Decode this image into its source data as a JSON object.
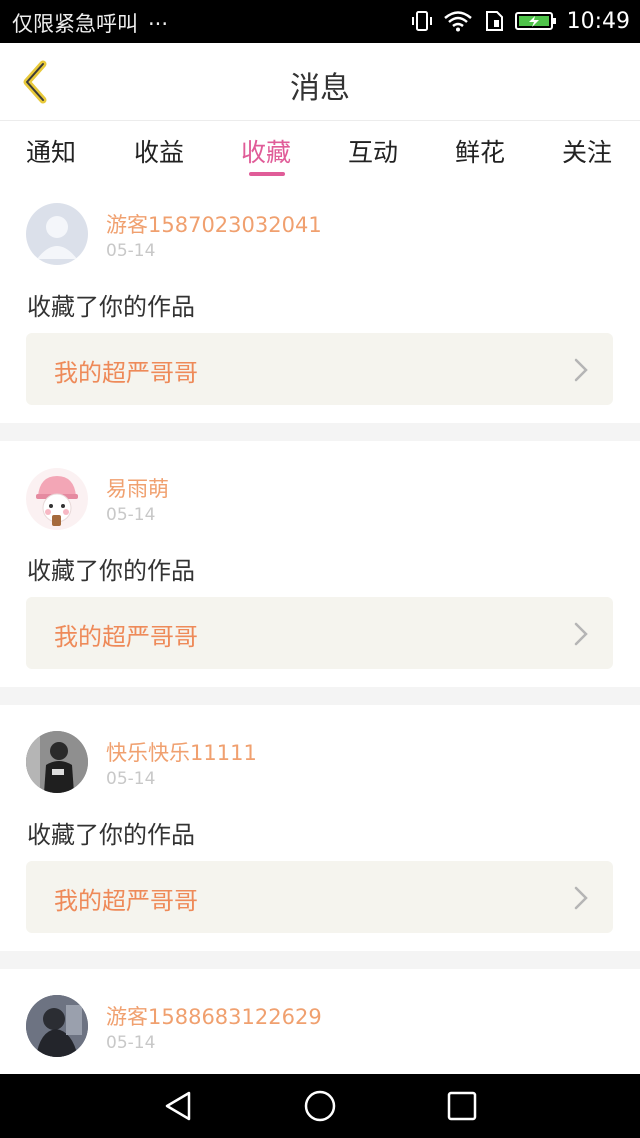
{
  "status_bar": {
    "carrier": "仅限紧急呼叫",
    "dots": "···",
    "time": "10:49"
  },
  "header": {
    "title": "消息"
  },
  "tabs": [
    {
      "label": "通知"
    },
    {
      "label": "收益"
    },
    {
      "label": "收藏",
      "active": true
    },
    {
      "label": "互动"
    },
    {
      "label": "鲜花"
    },
    {
      "label": "关注"
    }
  ],
  "items": [
    {
      "username": "游客1587023032041",
      "date": "05-14",
      "action": "收藏了你的作品",
      "work_title": "我的超严哥哥",
      "avatar": "default-avatar"
    },
    {
      "username": "易雨萌",
      "date": "05-14",
      "action": "收藏了你的作品",
      "work_title": "我的超严哥哥",
      "avatar": "cartoon-bear-avatar"
    },
    {
      "username": "快乐快乐11111",
      "date": "05-14",
      "action": "收藏了你的作品",
      "work_title": "我的超严哥哥",
      "avatar": "photo-avatar"
    },
    {
      "username": "游客1588683122629",
      "date": "05-14",
      "action": "",
      "work_title": "",
      "avatar": "photo-avatar"
    }
  ],
  "colors": {
    "accent": "#e05c98",
    "username": "#f0a06f",
    "work_title": "#ee8a59",
    "back_icon": "#e8c93a"
  }
}
